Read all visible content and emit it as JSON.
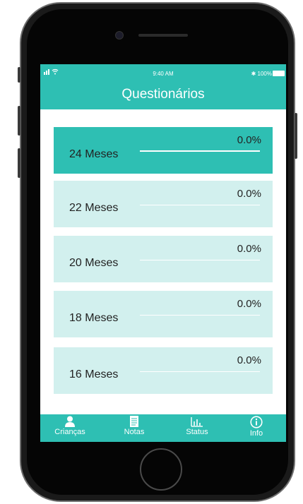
{
  "status": {
    "signal": "ıll",
    "wifi": "wifi-icon",
    "time": "9:40 AM",
    "bluetooth": "bluetooth-icon",
    "battery": "100%"
  },
  "header": {
    "title": "Questionários"
  },
  "questionnaires": [
    {
      "label": "24 Meses",
      "percent": "0.0%",
      "active": true
    },
    {
      "label": "22 Meses",
      "percent": "0.0%",
      "active": false
    },
    {
      "label": "20 Meses",
      "percent": "0.0%",
      "active": false
    },
    {
      "label": "18 Meses",
      "percent": "0.0%",
      "active": false
    },
    {
      "label": "16 Meses",
      "percent": "0.0%",
      "active": false
    }
  ],
  "tabs": [
    {
      "label": "Crianças",
      "icon": "person-icon"
    },
    {
      "label": "Notas",
      "icon": "notes-icon"
    },
    {
      "label": "Status",
      "icon": "bar-chart-icon"
    },
    {
      "label": "Info",
      "icon": "info-icon"
    }
  ],
  "colors": {
    "accent": "#2ebfb3",
    "card_light": "#d2f0ee"
  }
}
